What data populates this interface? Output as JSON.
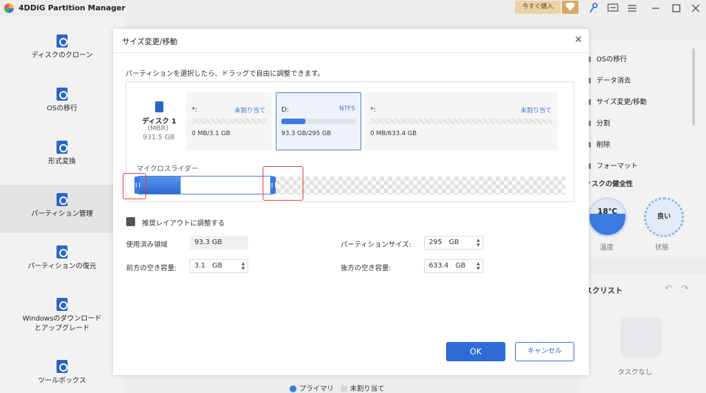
{
  "app": {
    "title": "4DDiG Partition Manager",
    "buy_label": "今すぐ購入"
  },
  "sidebar": {
    "items": [
      {
        "label": "ディスクのクローン"
      },
      {
        "label": "OSの移行"
      },
      {
        "label": "形式変換"
      },
      {
        "label": "パーティション管理"
      },
      {
        "label": "パーティションの復元"
      },
      {
        "label": "Windowsのダウンロード"
      },
      {
        "label": "とアップグレード"
      },
      {
        "label": "ツールボックス"
      }
    ]
  },
  "right_panel": {
    "items": [
      "OSの移行",
      "データ消去",
      "サイズ変更/移動",
      "分割",
      "削除",
      "フォーマット"
    ],
    "health_title": "ィスクの健全性",
    "temperature": "18℃",
    "temperature_label": "温度",
    "state": "良い",
    "state_label": "状態",
    "task_title": "スクリスト",
    "task_empty": "タスクなし"
  },
  "legend": {
    "primary": "プライマリ",
    "unallocated": "未割り当て"
  },
  "dialog": {
    "title": "サイズ変更/移動",
    "instruction": "パーティションを選択したら、ドラッグで自由に調整できます。",
    "disk": {
      "name": "ディスク 1",
      "type": "(MBR)",
      "size": "931.5 GB"
    },
    "partitions": [
      {
        "name": "*:",
        "type": "未割り当て",
        "size": "0 MB/3.1 GB",
        "fill": 0
      },
      {
        "name": "D:",
        "type": "NTFS",
        "size": "93.3 GB/295 GB",
        "fill": 0.32
      },
      {
        "name": "*:",
        "type": "未割り当て",
        "size": "0 MB/633.4 GB",
        "fill": 0
      }
    ],
    "micro_slider_label": "マイクロスライダー",
    "optimize_label": "推奨レイアウトに調整する",
    "fields": {
      "used_label": "使用済み領域",
      "used_value": "93.3 GB",
      "before_label": "前方の空き容量:",
      "before_value": "3.1",
      "before_unit": "GB",
      "size_label": "パーティションサイズ:",
      "size_value": "295",
      "size_unit": "GB",
      "after_label": "後方の空き容量:",
      "after_value": "633.4",
      "after_unit": "GB"
    },
    "ok_label": "OK",
    "cancel_label": "キャンセル"
  },
  "colors": {
    "accent": "#2d6bd6",
    "highlight": "#e23a3a"
  }
}
